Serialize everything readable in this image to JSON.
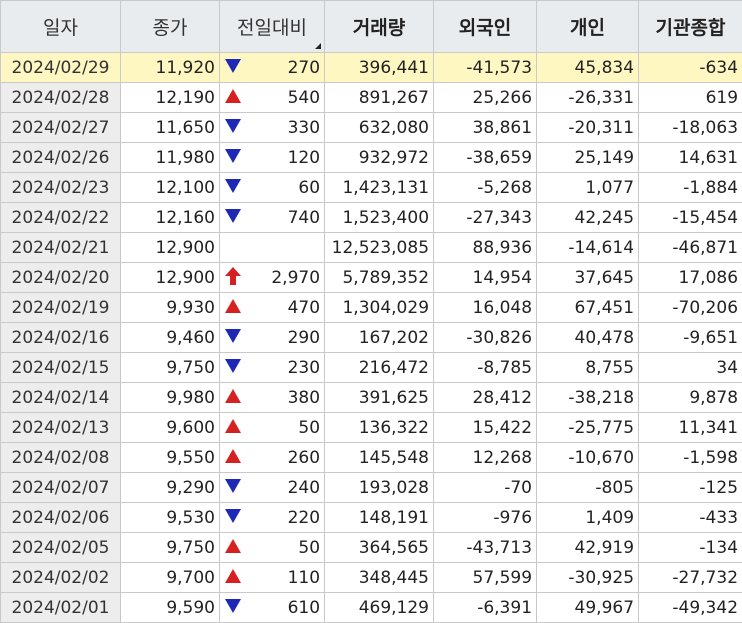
{
  "colors": {
    "up": "#d42222",
    "down": "#1d28b5",
    "neutral": "#222222",
    "selected_row": "#fff7c2"
  },
  "headers": {
    "date": "일자",
    "close": "종가",
    "change": "전일대비",
    "volume": "거래량",
    "foreign": "외국인",
    "individual": "개인",
    "institution": "기관종합"
  },
  "selected_index": 0,
  "rows": [
    {
      "date": "2024/02/29",
      "close": "11,920",
      "dir": "down",
      "change": "270",
      "volume": "396,441",
      "foreign": "-41,573",
      "individual": "45,834",
      "institution": "-634"
    },
    {
      "date": "2024/02/28",
      "close": "12,190",
      "dir": "up",
      "change": "540",
      "volume": "891,267",
      "foreign": "25,266",
      "individual": "-26,331",
      "institution": "619"
    },
    {
      "date": "2024/02/27",
      "close": "11,650",
      "dir": "down",
      "change": "330",
      "volume": "632,080",
      "foreign": "38,861",
      "individual": "-20,311",
      "institution": "-18,063"
    },
    {
      "date": "2024/02/26",
      "close": "11,980",
      "dir": "down",
      "change": "120",
      "volume": "932,972",
      "foreign": "-38,659",
      "individual": "25,149",
      "institution": "14,631"
    },
    {
      "date": "2024/02/23",
      "close": "12,100",
      "dir": "down",
      "change": "60",
      "volume": "1,423,131",
      "foreign": "-5,268",
      "individual": "1,077",
      "institution": "-1,884"
    },
    {
      "date": "2024/02/22",
      "close": "12,160",
      "dir": "down",
      "change": "740",
      "volume": "1,523,400",
      "foreign": "-27,343",
      "individual": "42,245",
      "institution": "-15,454"
    },
    {
      "date": "2024/02/21",
      "close": "12,900",
      "dir": "none",
      "change": "",
      "volume": "12,523,085",
      "foreign": "88,936",
      "individual": "-14,614",
      "institution": "-46,871"
    },
    {
      "date": "2024/02/20",
      "close": "12,900",
      "dir": "limit-up",
      "change": "2,970",
      "volume": "5,789,352",
      "foreign": "14,954",
      "individual": "37,645",
      "institution": "17,086"
    },
    {
      "date": "2024/02/19",
      "close": "9,930",
      "dir": "up",
      "change": "470",
      "volume": "1,304,029",
      "foreign": "16,048",
      "individual": "67,451",
      "institution": "-70,206"
    },
    {
      "date": "2024/02/16",
      "close": "9,460",
      "dir": "down",
      "change": "290",
      "volume": "167,202",
      "foreign": "-30,826",
      "individual": "40,478",
      "institution": "-9,651"
    },
    {
      "date": "2024/02/15",
      "close": "9,750",
      "dir": "down",
      "change": "230",
      "volume": "216,472",
      "foreign": "-8,785",
      "individual": "8,755",
      "institution": "34"
    },
    {
      "date": "2024/02/14",
      "close": "9,980",
      "dir": "up",
      "change": "380",
      "volume": "391,625",
      "foreign": "28,412",
      "individual": "-38,218",
      "institution": "9,878"
    },
    {
      "date": "2024/02/13",
      "close": "9,600",
      "dir": "up",
      "change": "50",
      "volume": "136,322",
      "foreign": "15,422",
      "individual": "-25,775",
      "institution": "11,341"
    },
    {
      "date": "2024/02/08",
      "close": "9,550",
      "dir": "up",
      "change": "260",
      "volume": "145,548",
      "foreign": "12,268",
      "individual": "-10,670",
      "institution": "-1,598"
    },
    {
      "date": "2024/02/07",
      "close": "9,290",
      "dir": "down",
      "change": "240",
      "volume": "193,028",
      "foreign": "-70",
      "individual": "-805",
      "institution": "-125"
    },
    {
      "date": "2024/02/06",
      "close": "9,530",
      "dir": "down",
      "change": "220",
      "volume": "148,191",
      "foreign": "-976",
      "individual": "1,409",
      "institution": "-433"
    },
    {
      "date": "2024/02/05",
      "close": "9,750",
      "dir": "up",
      "change": "50",
      "volume": "364,565",
      "foreign": "-43,713",
      "individual": "42,919",
      "institution": "-134"
    },
    {
      "date": "2024/02/02",
      "close": "9,700",
      "dir": "up",
      "change": "110",
      "volume": "348,445",
      "foreign": "57,599",
      "individual": "-30,925",
      "institution": "-27,732"
    },
    {
      "date": "2024/02/01",
      "close": "9,590",
      "dir": "down",
      "change": "610",
      "volume": "469,129",
      "foreign": "-6,391",
      "individual": "49,967",
      "institution": "-49,342"
    }
  ]
}
